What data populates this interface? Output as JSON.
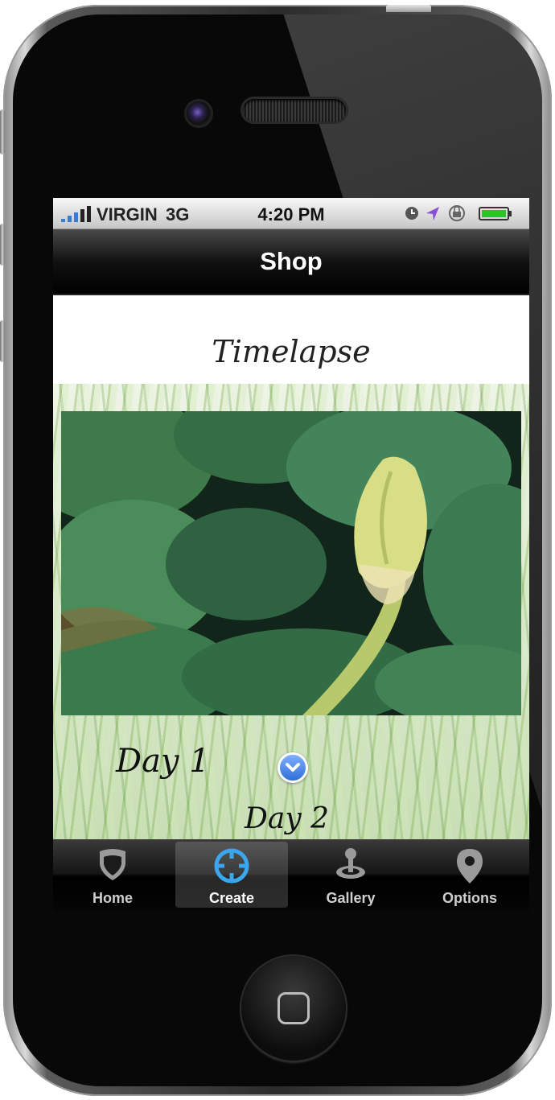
{
  "status_bar": {
    "carrier": "VIRGIN",
    "network": "3G",
    "time": "4:20 PM"
  },
  "nav": {
    "title": "Shop"
  },
  "content": {
    "title": "Timelapse",
    "day1": "Day 1",
    "day2": "Day 2"
  },
  "tabs": [
    {
      "label": "Home",
      "icon": "shield-icon"
    },
    {
      "label": "Create",
      "icon": "crosshair-icon"
    },
    {
      "label": "Gallery",
      "icon": "joystick-icon"
    },
    {
      "label": "Options",
      "icon": "map-pin-icon"
    }
  ],
  "selected_tab": "Create",
  "colors": {
    "accent": "#2f8fd8",
    "selection_blue": "#2f6ed8"
  }
}
